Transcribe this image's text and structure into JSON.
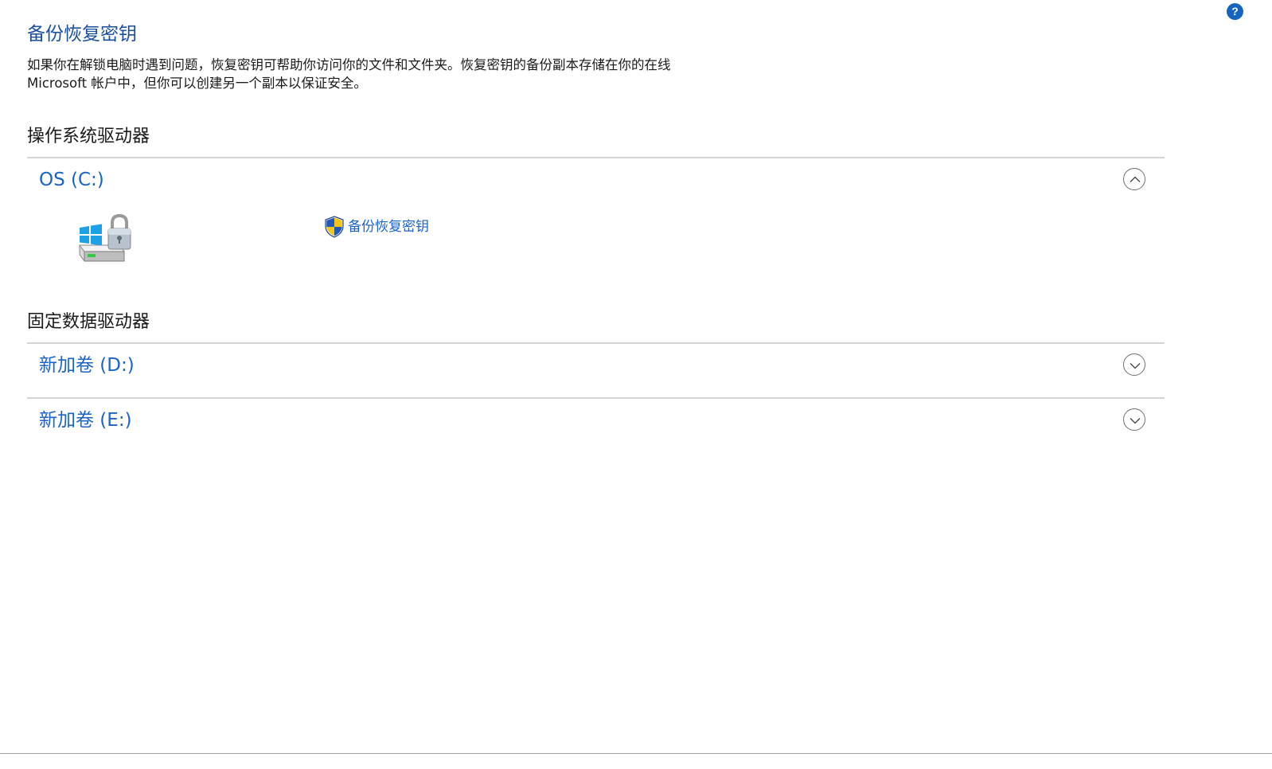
{
  "help": {
    "label": "?"
  },
  "header": {
    "title": "备份恢复密钥",
    "description": "如果你在解锁电脑时遇到问题，恢复密钥可帮助你访问你的文件和文件夹。恢复密钥的备份副本存储在你的在线 Microsoft 帐户中，但你可以创建另一个副本以保证安全。"
  },
  "os_section": {
    "heading": "操作系统驱动器",
    "drive": {
      "name": "OS (C:)",
      "expanded": true,
      "icon": "bitlocker-drive-icon",
      "action_label": "备份恢复密钥",
      "action_icon": "uac-shield-icon"
    }
  },
  "fixed_section": {
    "heading": "固定数据驱动器",
    "drives": [
      {
        "name": "新加卷 (D:)",
        "expanded": false
      },
      {
        "name": "新加卷 (E:)",
        "expanded": false
      }
    ]
  },
  "colors": {
    "title": "#1a4fa0",
    "link": "#1a64c8",
    "help": "#1565c0",
    "divider": "#d4d4d4"
  }
}
